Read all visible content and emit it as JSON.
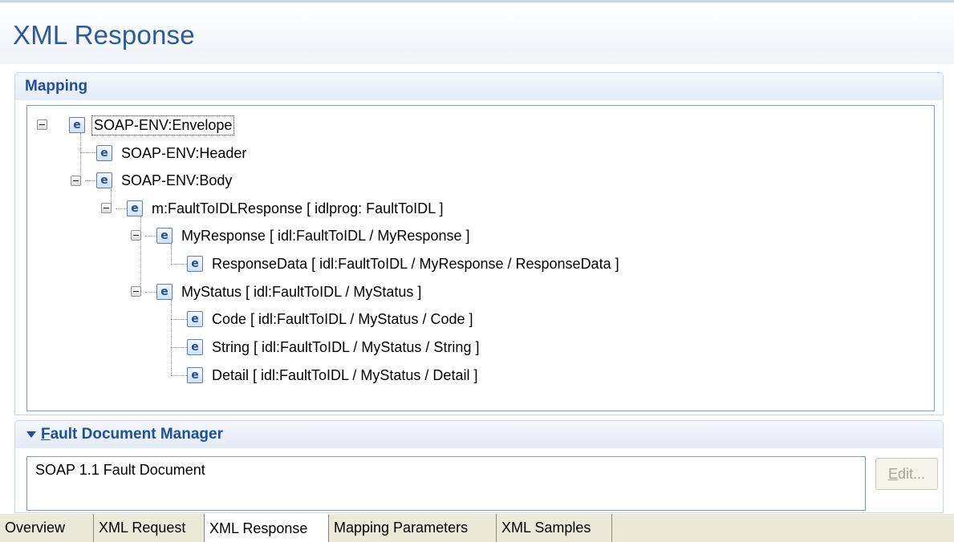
{
  "editor": {
    "title": "XML Response"
  },
  "mapping": {
    "section_title": "Mapping",
    "tree": [
      {
        "icon": "e",
        "label": "SOAP-ENV:Envelope"
      },
      {
        "icon": "e",
        "label": "SOAP-ENV:Header"
      },
      {
        "icon": "e",
        "label": "SOAP-ENV:Body"
      },
      {
        "icon": "e",
        "label": "m:FaultToIDLResponse  [ idlprog: FaultToIDL ]"
      },
      {
        "icon": "e",
        "label": "MyResponse  [ idl:FaultToIDL / MyResponse ]"
      },
      {
        "icon": "e",
        "label": "ResponseData  [ idl:FaultToIDL / MyResponse / ResponseData ]"
      },
      {
        "icon": "e",
        "label": "MyStatus  [ idl:FaultToIDL / MyStatus ]"
      },
      {
        "icon": "e",
        "label": "Code  [ idl:FaultToIDL / MyStatus / Code ]"
      },
      {
        "icon": "e",
        "label": "String  [ idl:FaultToIDL / MyStatus / String ]"
      },
      {
        "icon": "e",
        "label": "Detail  [ idl:FaultToIDL / MyStatus / Detail ]"
      }
    ]
  },
  "fault_manager": {
    "section_title_mnemonic": "F",
    "section_title_rest": "ault Document Manager",
    "document": "SOAP 1.1 Fault Document",
    "edit_mnemonic": "E",
    "edit_rest": "dit..."
  },
  "tabs": [
    {
      "label": "Overview"
    },
    {
      "label": "XML Request"
    },
    {
      "label": "XML Response"
    },
    {
      "label": "Mapping Parameters"
    },
    {
      "label": "XML Samples"
    }
  ],
  "colors": {
    "title": "#2c5a9e",
    "section_title": "#1e4f9c",
    "tab_bar": "#ece9d8"
  }
}
